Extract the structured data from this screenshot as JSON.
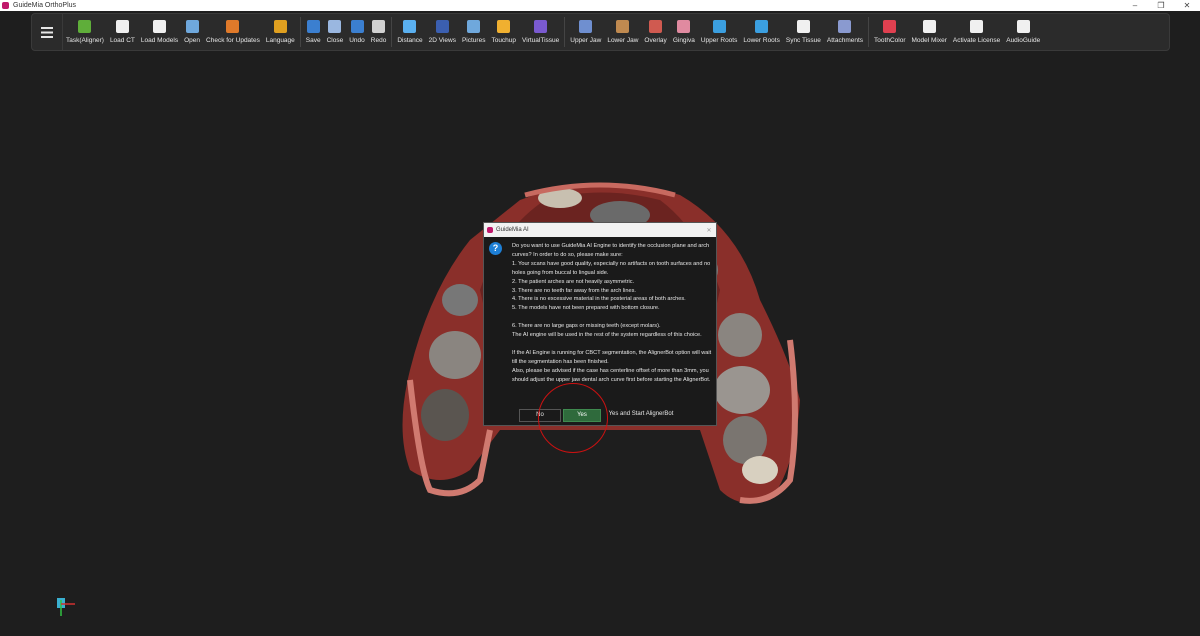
{
  "window": {
    "title": "GuideMia OrthoPlus",
    "controls": [
      "–",
      "❐",
      "✕"
    ]
  },
  "toolbar": {
    "tools": [
      {
        "label": "Task(Aligner)",
        "icon": "gear-icon",
        "color": "#5fae3a"
      },
      {
        "label": "Load CT",
        "icon": "document-icon",
        "color": "#f0f0f0"
      },
      {
        "label": "Load Models",
        "icon": "document-icon",
        "color": "#f0f0f0"
      },
      {
        "label": "Open",
        "icon": "folder-open-icon",
        "color": "#6fa8dc"
      },
      {
        "label": "Check for Updates",
        "icon": "refresh-icon",
        "color": "#e07a2a"
      },
      {
        "label": "Language",
        "icon": "language-icon",
        "color": "#e0a020"
      },
      {
        "label": "Save",
        "icon": "save-icon",
        "color": "#3b7fd0"
      },
      {
        "label": "Close",
        "icon": "close-file-icon",
        "color": "#9ab7e0"
      },
      {
        "label": "Undo",
        "icon": "undo-icon",
        "color": "#3b7fd0"
      },
      {
        "label": "Redo",
        "icon": "redo-icon",
        "color": "#d0d0d0"
      },
      {
        "label": "Distance",
        "icon": "ruler-icon",
        "color": "#5ab0f0"
      },
      {
        "label": "2D Views",
        "icon": "views-icon",
        "color": "#3b5fb0"
      },
      {
        "label": "Pictures",
        "icon": "picture-icon",
        "color": "#6fa8dc"
      },
      {
        "label": "Touchup",
        "icon": "touchup-icon",
        "color": "#f0b030"
      },
      {
        "label": "VirtualTissue",
        "icon": "tissue-icon",
        "color": "#7a5ad0"
      },
      {
        "label": "Upper Jaw",
        "icon": "upper-jaw-icon",
        "color": "#6f8fd0"
      },
      {
        "label": "Lower Jaw",
        "icon": "lower-jaw-icon",
        "color": "#c08a50"
      },
      {
        "label": "Overlay",
        "icon": "overlay-icon",
        "color": "#d05a50"
      },
      {
        "label": "Gingiva",
        "icon": "gingiva-icon",
        "color": "#e08aa0"
      },
      {
        "label": "Upper Roots",
        "icon": "root-icon",
        "color": "#3b9fe0"
      },
      {
        "label": "Lower Roots",
        "icon": "root-icon",
        "color": "#3b9fe0"
      },
      {
        "label": "Sync Tissue",
        "icon": "teeth-icon",
        "color": "#f0f0f0"
      },
      {
        "label": "Attachments",
        "icon": "attachment-icon",
        "color": "#8a9ad0"
      },
      {
        "label": "ToothColor",
        "icon": "tooth-color-icon",
        "color": "#e04050"
      },
      {
        "label": "Model Mixer",
        "icon": "cube-icon",
        "color": "#f0f0f0"
      },
      {
        "label": "Activate License",
        "icon": "key-icon",
        "color": "#f0f0f0"
      },
      {
        "label": "AudioGuide",
        "icon": "microphone-icon",
        "color": "#f0f0f0"
      }
    ]
  },
  "dialog": {
    "title": "GuideMia AI",
    "close": "✕",
    "icon": "question-icon",
    "paragraphs": [
      "Do you want to use GuideMia AI Engine to identify the occlusion plane and arch curves? In order to do so, please make sure:",
      "1. Your scans have good quality, especially no artifacts on tooth surfaces and no holes going from buccal to lingual side.",
      "2. The patient arches are not heavily asymmetric.",
      "3. There are no teeth far away from the arch lines.",
      "4. There is no excessive material in the posterial areas of both arches.",
      "5. The models have not been prepared with bottom closure.",
      "",
      "6. There are no large gaps or missing teeth (except molars).",
      "The AI engine will be used in the rest of the system regardless of this choice.",
      "",
      "If the AI Engine is running for CBCT segmentation, the AlignerBot option will wait till the segmentation has been finished.",
      "Also, please be advised if the case has centerline offset of more than 3mm, you should adjust the upper jaw dental arch curve first before starting the AlignerBot."
    ],
    "buttons": {
      "no": "No",
      "yes": "Yes",
      "yes_start": "Yes and Start AlignerBot"
    }
  }
}
